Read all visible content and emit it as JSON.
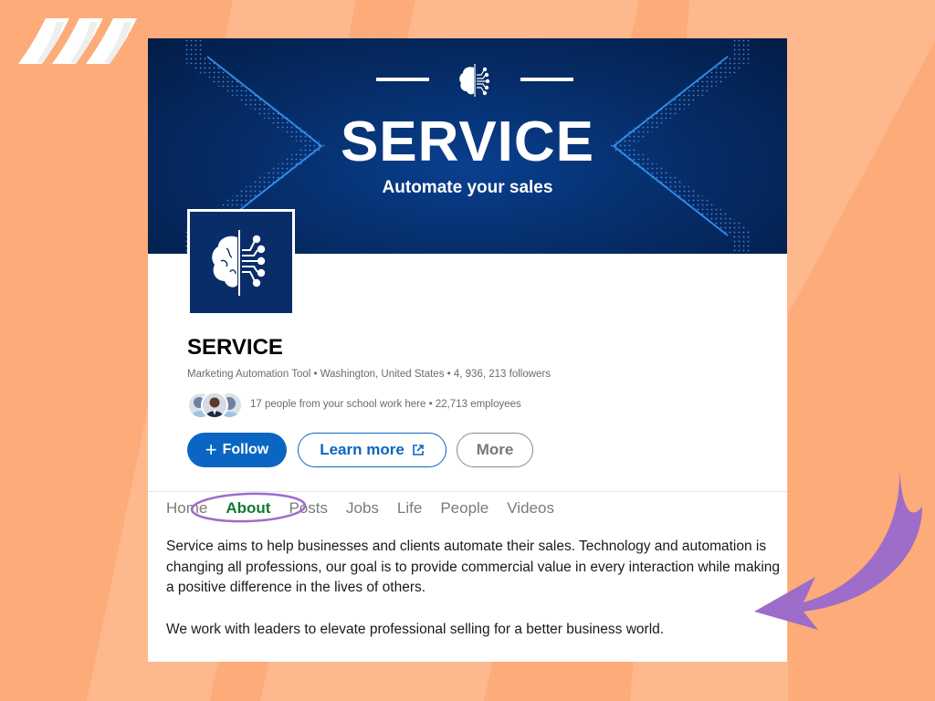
{
  "colors": {
    "background": "#fdab78",
    "stripe": "#fdb88d",
    "banner": "#06306f",
    "logo_bg": "#082d68",
    "linkedin_blue": "#0a66c2",
    "active_tab": "#0f7a34",
    "annotation": "#9e6cc9"
  },
  "banner": {
    "title": "SERVICE",
    "subtitle": "Automate your sales",
    "icon": "brain-circuit-icon"
  },
  "company": {
    "name": "SERVICE",
    "meta": "Marketing Automation Tool • Washington, United States • 4, 936, 213 followers",
    "people_text": "17 people from your school work here • 22,713 employees",
    "logo_icon": "brain-circuit-icon"
  },
  "actions": {
    "follow": "Follow",
    "follow_icon": "plus-icon",
    "learn_more": "Learn more",
    "learn_more_icon": "external-link-icon",
    "more": "More"
  },
  "tabs": [
    {
      "label": "Home",
      "active": false
    },
    {
      "label": "About",
      "active": true
    },
    {
      "label": "Posts",
      "active": false
    },
    {
      "label": "Jobs",
      "active": false
    },
    {
      "label": "Life",
      "active": false
    },
    {
      "label": "People",
      "active": false
    },
    {
      "label": "Videos",
      "active": false
    }
  ],
  "about": {
    "paragraphs": [
      "Service aims to help businesses and clients automate their sales. Technology and automation is changing all professions, our goal is to provide commercial value in every interaction while making a positive difference in the lives of others.",
      "We work with leaders to elevate professional selling for a better business world."
    ]
  },
  "annotations": {
    "highlight": "ellipse-around-about-tab",
    "arrow": "curved-arrow-pointing-to-about-text"
  }
}
